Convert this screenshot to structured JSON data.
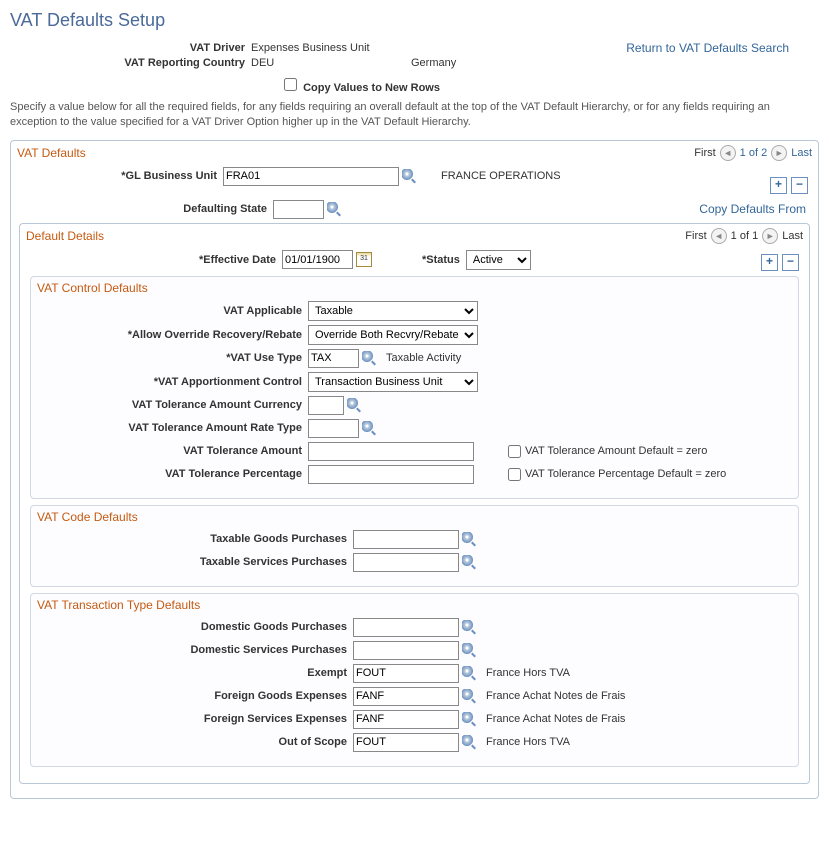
{
  "pageTitle": "VAT Defaults Setup",
  "returnLink": "Return to VAT Defaults Search",
  "header": {
    "vatDriverLabel": "VAT Driver",
    "vatDriverValue": "Expenses Business Unit",
    "vatCountryLabel": "VAT Reporting Country",
    "vatCountryCode": "DEU",
    "vatCountryName": "Germany",
    "copyRowsLabel": "Copy Values to New Rows",
    "description": "Specify a value below for all the required fields, for any fields requiring an overall default at the top of the VAT Default Hierarchy, or for any fields requiring an exception to the value specified for a VAT Driver Option higher up in the VAT Default Hierarchy."
  },
  "vatDefaults": {
    "sectionTitle": "VAT Defaults",
    "pager": {
      "first": "First",
      "range": "1 of 2",
      "last": "Last"
    },
    "glBULabel": "*GL Business Unit",
    "glBUValue": "FRA01",
    "glBUName": "FRANCE OPERATIONS",
    "defStateLabel": "Defaulting State",
    "defStateValue": "",
    "copyDefaultsFrom": "Copy Defaults From"
  },
  "defaultDetails": {
    "sectionTitle": "Default Details",
    "pager": {
      "first": "First",
      "range": "1 of 1",
      "last": "Last"
    },
    "effDateLabel": "*Effective Date",
    "effDateValue": "01/01/1900",
    "statusLabel": "*Status",
    "statusValue": "Active"
  },
  "control": {
    "sectionTitle": "VAT Control Defaults",
    "applicableLabel": "VAT Applicable",
    "applicableValue": "Taxable",
    "overrideLabel": "*Allow Override Recovery/Rebate",
    "overrideValue": "Override Both Recvry/Rebate %",
    "useTypeLabel": "*VAT Use Type",
    "useTypeValue": "TAX",
    "useTypeText": "Taxable Activity",
    "apportLabel": "*VAT Apportionment Control",
    "apportValue": "Transaction Business Unit",
    "tolCurrLabel": "VAT Tolerance Amount Currency",
    "tolCurrValue": "",
    "tolRateLabel": "VAT Tolerance Amount Rate Type",
    "tolRateValue": "",
    "tolAmtLabel": "VAT Tolerance Amount",
    "tolAmtValue": "",
    "tolAmtZero": "VAT Tolerance Amount Default = zero",
    "tolPctLabel": "VAT Tolerance Percentage",
    "tolPctValue": "",
    "tolPctZero": "VAT Tolerance Percentage Default = zero"
  },
  "codeDefaults": {
    "sectionTitle": "VAT Code Defaults",
    "goodsLabel": "Taxable Goods Purchases",
    "goodsValue": "",
    "servicesLabel": "Taxable Services Purchases",
    "servicesValue": ""
  },
  "txnDefaults": {
    "sectionTitle": "VAT Transaction Type Defaults",
    "rows": [
      {
        "label": "Domestic Goods Purchases",
        "value": "",
        "desc": ""
      },
      {
        "label": "Domestic Services Purchases",
        "value": "",
        "desc": ""
      },
      {
        "label": "Exempt",
        "value": "FOUT",
        "desc": "France Hors TVA"
      },
      {
        "label": "Foreign Goods Expenses",
        "value": "FANF",
        "desc": "France Achat Notes de Frais"
      },
      {
        "label": "Foreign Services Expenses",
        "value": "FANF",
        "desc": "France Achat Notes de Frais"
      },
      {
        "label": "Out of Scope",
        "value": "FOUT",
        "desc": "France Hors TVA"
      }
    ]
  }
}
